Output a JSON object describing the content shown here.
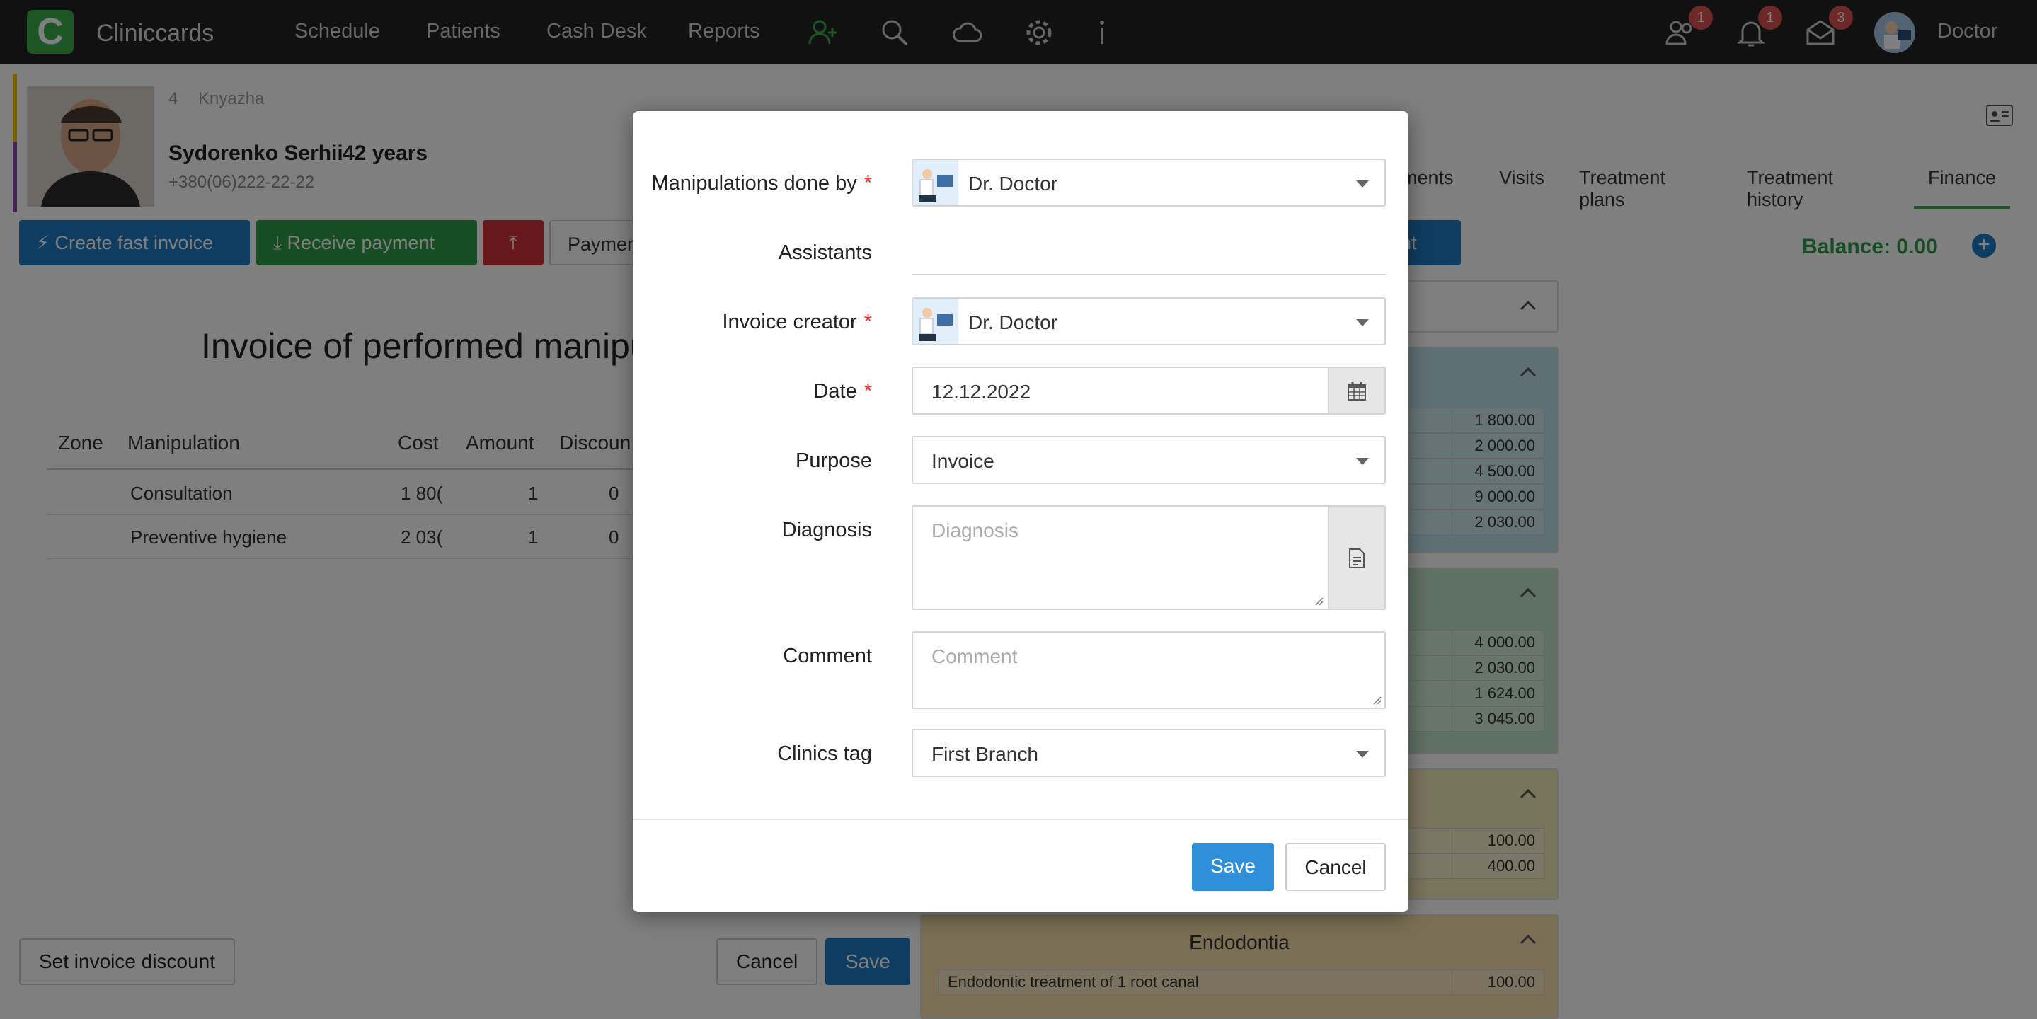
{
  "app": {
    "brand": "Cliniccards",
    "logo_letter": "C",
    "nav": [
      "Schedule",
      "Patients",
      "Cash Desk",
      "Reports"
    ],
    "badges": {
      "users": "1",
      "bell": "1",
      "mail": "3"
    },
    "user_name": "Doctor"
  },
  "patient": {
    "number": "4",
    "street": "Knyazha",
    "name": "Sydorenko Serhii",
    "age": "42 years",
    "phone": "+380(06)222-22-22",
    "tabs": [
      "ments",
      "Visits",
      "Treatment plans",
      "Treatment history",
      "Finance"
    ],
    "active_tab": "Finance"
  },
  "toolbar": {
    "create_fast_invoice": "Create fast invoice",
    "receive_payment": "Receive payment",
    "payment_partial": "Paymen",
    "ent_partial": "ent",
    "balance": "Balance: 0.00"
  },
  "invoice": {
    "title": "Invoice of performed manipu",
    "columns": [
      "Zone",
      "Manipulation",
      "Cost",
      "Amount",
      "Discoun"
    ],
    "rows": [
      {
        "zone": "",
        "manipulation": "Consultation",
        "cost": "1 80(",
        "amount": "1",
        "discount": "0"
      },
      {
        "zone": "",
        "manipulation": "Preventive hygiene",
        "cost": "2 03(",
        "amount": "1",
        "discount": "0"
      }
    ],
    "set_discount": "Set invoice discount",
    "cancel": "Cancel",
    "save": "Save"
  },
  "groups": [
    {
      "color": "#bfe0ea",
      "prices": [
        "1 800.00",
        "2 000.00",
        "4 500.00",
        "9 000.00",
        "2 030.00"
      ]
    },
    {
      "color": "#bfe3c6",
      "prices": [
        "4 000.00",
        "2 030.00",
        "1 624.00",
        "3 045.00"
      ]
    },
    {
      "color": "#f3e8b8",
      "prices": [
        "100.00",
        "400.00"
      ]
    },
    {
      "color": "#f5dfa8",
      "title": "Endodontia",
      "items": [
        {
          "name": "Endodontic treatment of 1 root canal",
          "price": "100.00"
        }
      ]
    }
  ],
  "modal": {
    "manipulations_label": "Manipulations done by",
    "manipulations_value": "Dr. Doctor",
    "assistants_label": "Assistants",
    "invoice_creator_label": "Invoice creator",
    "invoice_creator_value": "Dr. Doctor",
    "date_label": "Date",
    "date_value": "12.12.2022",
    "purpose_label": "Purpose",
    "purpose_value": "Invoice",
    "diagnosis_label": "Diagnosis",
    "diagnosis_placeholder": "Diagnosis",
    "comment_label": "Comment",
    "comment_placeholder": "Comment",
    "clinics_tag_label": "Clinics tag",
    "clinics_tag_value": "First Branch",
    "required_mark": "*",
    "save": "Save",
    "cancel": "Cancel"
  },
  "colors": {
    "accent_blue": "#1f7bc2",
    "accent_green": "#2e9a45",
    "danger_red": "#cf3036",
    "modal_save": "#2f8fd8"
  }
}
